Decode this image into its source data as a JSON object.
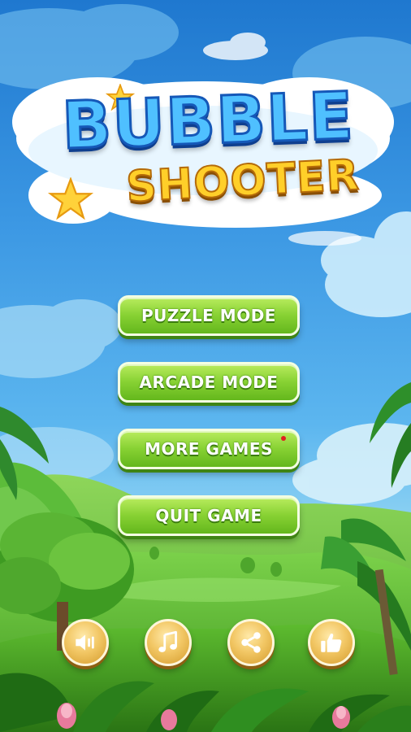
{
  "title": {
    "line1": "BUBBLE",
    "line2": "SHOOTER"
  },
  "menu": {
    "puzzle_mode": "PUZZLE MODE",
    "arcade_mode": "ARCADE MODE",
    "more_games": "MORE GAMES",
    "quit_game": "QUIT GAME"
  },
  "icons": {
    "sound": "speaker-icon",
    "music": "music-note-icon",
    "share": "share-icon",
    "like": "thumbs-up-icon"
  },
  "colors": {
    "button_green": "#88d234",
    "button_gold": "#f2c765",
    "title_blue": "#4fc0ff",
    "title_yellow": "#ffcf29",
    "notification_dot": "#e02020"
  }
}
